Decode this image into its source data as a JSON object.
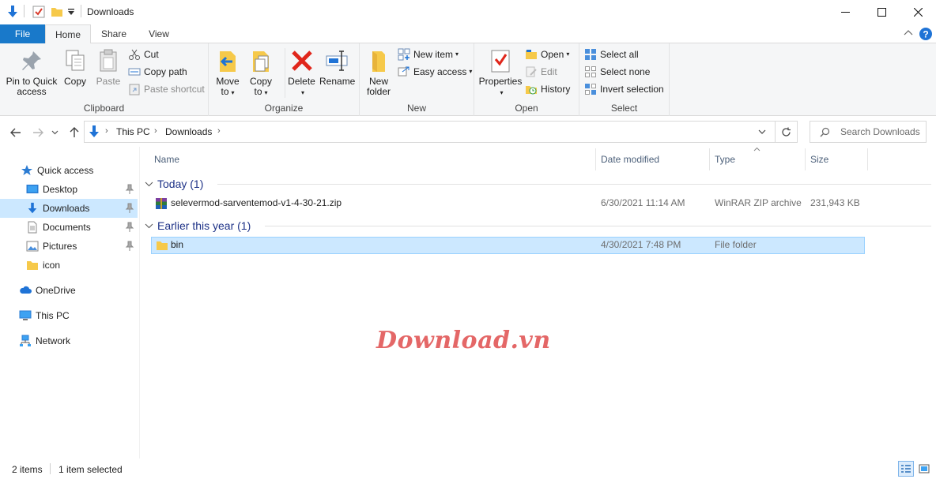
{
  "window": {
    "title": "Downloads",
    "accent": "#1979ca",
    "selection_color": "#cce8ff"
  },
  "ribbon_tabs": [
    "File",
    "Home",
    "Share",
    "View"
  ],
  "ribbon": {
    "clipboard": {
      "group_label": "Clipboard",
      "pin_label_1": "Pin to Quick",
      "pin_label_2": "access",
      "copy_label": "Copy",
      "paste_label": "Paste",
      "cut_label": "Cut",
      "copy_path_label": "Copy path",
      "paste_shortcut_label": "Paste shortcut"
    },
    "organize": {
      "group_label": "Organize",
      "move_to_1": "Move",
      "move_to_2": "to",
      "copy_to_1": "Copy",
      "copy_to_2": "to",
      "delete_label": "Delete",
      "rename_label": "Rename"
    },
    "new": {
      "group_label": "New",
      "new_folder_1": "New",
      "new_folder_2": "folder",
      "new_item_label": "New item",
      "easy_access_label": "Easy access"
    },
    "open": {
      "group_label": "Open",
      "properties_label": "Properties",
      "open_label": "Open",
      "edit_label": "Edit",
      "history_label": "History"
    },
    "select": {
      "group_label": "Select",
      "select_all_label": "Select all",
      "select_none_label": "Select none",
      "invert_selection_label": "Invert selection"
    }
  },
  "address": {
    "crumbs": [
      "This PC",
      "Downloads"
    ],
    "search_placeholder": "Search Downloads"
  },
  "nav_pane": {
    "items": [
      {
        "label": "Quick access",
        "icon": "star-icon"
      },
      {
        "label": "Desktop",
        "icon": "desktop-icon",
        "pinned": true
      },
      {
        "label": "Downloads",
        "icon": "download-arrow-icon",
        "pinned": true,
        "selected": true
      },
      {
        "label": "Documents",
        "icon": "document-icon",
        "pinned": true
      },
      {
        "label": "Pictures",
        "icon": "pictures-icon",
        "pinned": true
      },
      {
        "label": "icon",
        "icon": "folder-icon"
      },
      {
        "label": "OneDrive",
        "icon": "cloud-icon"
      },
      {
        "label": "This PC",
        "icon": "computer-icon"
      },
      {
        "label": "Network",
        "icon": "network-icon"
      }
    ]
  },
  "file_list": {
    "columns": [
      "Name",
      "Date modified",
      "Type",
      "Size"
    ],
    "groups": [
      {
        "header": "Today (1)",
        "rows": [
          {
            "name": "selevermod-sarventemod-v1-4-30-21.zip",
            "date": "6/30/2021 11:14 AM",
            "type": "WinRAR ZIP archive",
            "size": "231,943 KB",
            "icon": "winrar-archive-icon"
          }
        ]
      },
      {
        "header": "Earlier this year (1)",
        "rows": [
          {
            "name": "bin",
            "date": "4/30/2021 7:48 PM",
            "type": "File folder",
            "size": "",
            "icon": "folder-icon",
            "selected": true
          }
        ]
      }
    ]
  },
  "status": {
    "item_count": "2 items",
    "selected_count": "1 item selected"
  },
  "watermark": "Download.vn"
}
